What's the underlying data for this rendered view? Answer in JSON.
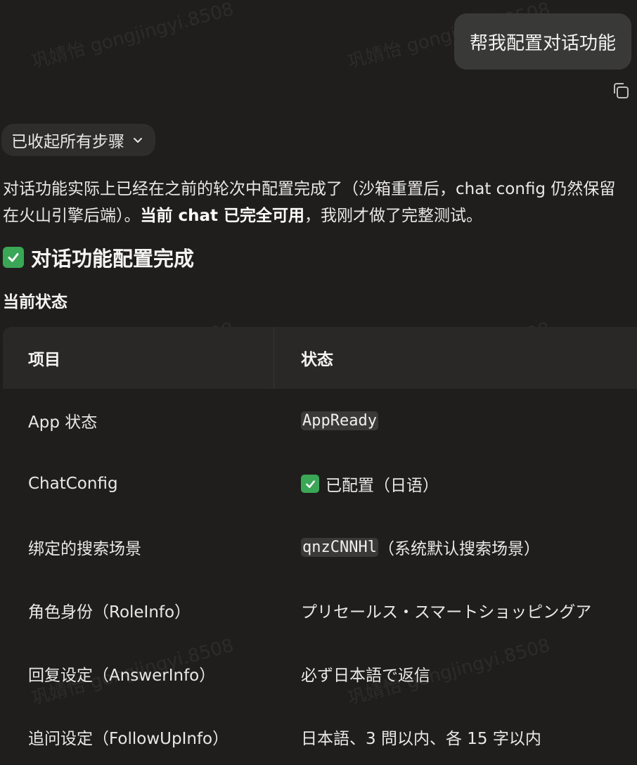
{
  "watermark": "巩婧怡 gongjingyi.8508",
  "user_message": "帮我配置对话功能",
  "steps_toggle": {
    "label": "已收起所有步骤"
  },
  "intro": {
    "text": "对话功能实际上已经在之前的轮次中配置完成了（沙箱重置后，chat config 仍然保留在火山引擎后端）。",
    "bold": "当前 chat 已完全可用",
    "tail": "，我刚才做了完整测试。"
  },
  "heading": "对话功能配置完成",
  "subheading": "当前状态",
  "table": {
    "headers": [
      "项目",
      "状态"
    ],
    "rows": [
      {
        "item": "App 状态",
        "code": "AppReady",
        "check": false,
        "text": ""
      },
      {
        "item": "ChatConfig",
        "code": "",
        "check": true,
        "text": "已配置（日语）"
      },
      {
        "item": "绑定的搜索场景",
        "code": "qnzCNNHl",
        "check": false,
        "text": "（系统默认搜索场景）"
      },
      {
        "item": "角色身份（RoleInfo）",
        "code": "",
        "check": false,
        "text": "プリセールス・スマートショッピングア"
      },
      {
        "item": "回复设定（AnswerInfo）",
        "code": "",
        "check": false,
        "text": "必ず日本語で返信"
      },
      {
        "item": "追问设定（FollowUpInfo）",
        "code": "",
        "check": false,
        "text": "日本語、3 問以内、各 15 字以内"
      }
    ]
  },
  "icons": {
    "copy": "copy-icon",
    "chevron": "chevron-down-icon",
    "check": "check-mark-icon"
  },
  "colors": {
    "background": "#1f1e1d",
    "bubble": "#393937",
    "check_green": "#3aa757",
    "code_bg": "#3a3937"
  }
}
